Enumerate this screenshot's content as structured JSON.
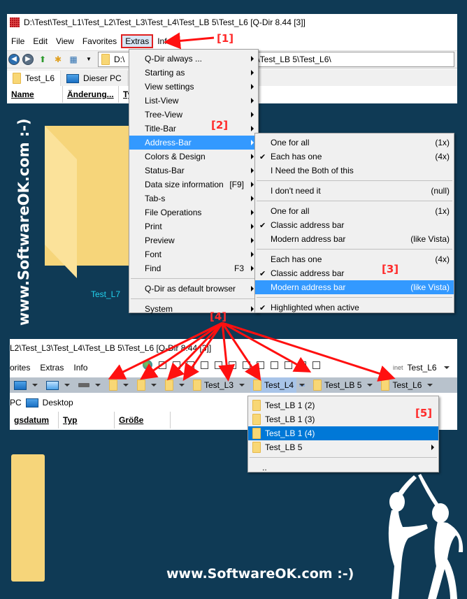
{
  "window1": {
    "title": "D:\\Test\\Test_L1\\Test_L2\\Test_L3\\Test_L4\\Test_LB 5\\Test_L6  [Q-Dir 8.44 [3]]",
    "menu": [
      "File",
      "Edit",
      "View",
      "Favorites",
      "Extras",
      "Info"
    ],
    "address": "D:\\Test\\Test_L1\\Test_L2\\Test_L3\\Test_L4\\Test_LB 5\\Test_L6\\",
    "address_visible_start": "D:\\",
    "address_visible_end": "\\Test_LB 5\\Test_L6\\",
    "tabs": [
      "Test_L6",
      "Dieser PC"
    ],
    "columns": [
      "Name",
      "Änderung...",
      "Ty"
    ],
    "folder_label": "Test_L7"
  },
  "extras_menu": {
    "items": [
      {
        "label": "Q-Dir always ...",
        "shortcut": "",
        "submenu": true
      },
      {
        "label": "Starting as",
        "shortcut": "",
        "submenu": true
      },
      {
        "label": "View settings",
        "shortcut": "",
        "submenu": true
      },
      {
        "label": "List-View",
        "shortcut": "",
        "submenu": true
      },
      {
        "label": "Tree-View",
        "shortcut": "",
        "submenu": true
      },
      {
        "label": "Title-Bar",
        "shortcut": "",
        "submenu": true
      },
      {
        "label": "Address-Bar",
        "shortcut": "",
        "submenu": true,
        "highlighted": true
      },
      {
        "label": "Colors & Design",
        "shortcut": "",
        "submenu": true
      },
      {
        "label": "Status-Bar",
        "shortcut": "",
        "submenu": true
      },
      {
        "label": "Data size information",
        "shortcut": "[F9]",
        "submenu": true
      },
      {
        "label": "Tab-s",
        "shortcut": "",
        "submenu": true
      },
      {
        "label": "File Operations",
        "shortcut": "",
        "submenu": true
      },
      {
        "label": "Print",
        "shortcut": "",
        "submenu": true
      },
      {
        "label": "Preview",
        "shortcut": "",
        "submenu": true
      },
      {
        "label": "Font",
        "shortcut": "",
        "submenu": true
      },
      {
        "label": "Find",
        "shortcut": "F3",
        "submenu": true
      },
      {
        "label": "Q-Dir as default browser",
        "shortcut": "",
        "submenu": true
      },
      {
        "label": "System",
        "shortcut": "",
        "submenu": true
      }
    ]
  },
  "address_bar_submenu": {
    "items": [
      {
        "label": "One for all",
        "value": "(1x)",
        "checked": false
      },
      {
        "label": "Each has one",
        "value": "(4x)",
        "checked": true
      },
      {
        "label": "I Need the Both of this",
        "value": "",
        "checked": false
      },
      {
        "label": "I don't need it",
        "value": "(null)",
        "checked": false
      },
      {
        "label": "One for all",
        "value": "(1x)",
        "checked": false
      },
      {
        "label": "Classic address bar",
        "value": "",
        "checked": true
      },
      {
        "label": "Modern address bar",
        "value": "(like Vista)",
        "checked": false
      },
      {
        "label": "Each has one",
        "value": "(4x)",
        "checked": false
      },
      {
        "label": "Classic address bar",
        "value": "",
        "checked": true
      },
      {
        "label": "Modern address bar",
        "value": "(like Vista)",
        "checked": false,
        "highlighted": true
      },
      {
        "label": "Highlighted when active",
        "value": "",
        "checked": true
      }
    ]
  },
  "window2": {
    "title": "L2\\Test_L3\\Test_L4\\Test_LB 5\\Test_L6  [Q-Dir 8.44 [3]]",
    "menu": [
      "orites",
      "Extras",
      "Info"
    ],
    "right_label": "Test_L6",
    "inet_label": "inet",
    "breadcrumbs": [
      "Test_L3",
      "Test_L4",
      "Test_LB 5",
      "Test_L6"
    ],
    "tabs": [
      "PC",
      "Desktop"
    ],
    "columns": [
      "gsdatum",
      "Typ",
      "Größe"
    ]
  },
  "breadcrumb_popup": {
    "items": [
      {
        "label": "Test_LB 1 (2)",
        "submenu": false
      },
      {
        "label": "Test_LB 1 (3)",
        "submenu": false
      },
      {
        "label": "Test_LB 1 (4)",
        "submenu": false,
        "highlighted": true
      },
      {
        "label": "Test_LB 5",
        "submenu": true
      },
      {
        "label": "..",
        "submenu": false
      }
    ]
  },
  "annotations": [
    "[1]",
    "[2]",
    "[3]",
    "[4]",
    "[5]"
  ],
  "watermark": {
    "vertical": "www.SoftwareOK.com :-)",
    "footer": "www.SoftwareOK.com :-)"
  },
  "colors": {
    "background": "#0f3a55",
    "menu_highlight": "#3399ff",
    "annotation": "#ff2a2a",
    "folder": "#f6d57a"
  }
}
